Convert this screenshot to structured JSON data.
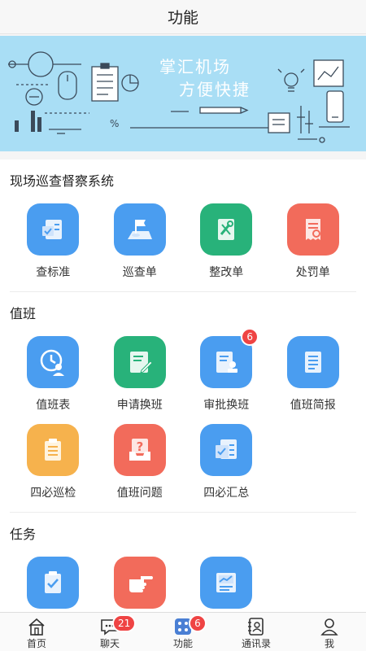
{
  "header": {
    "title": "功能"
  },
  "banner": {
    "line1": "掌汇机场",
    "line2": "方便快捷"
  },
  "sections": [
    {
      "title": "现场巡查督察系统",
      "items": [
        {
          "label": "查标准",
          "color": "#4a9df0",
          "icon": "checklist-icon"
        },
        {
          "label": "巡查单",
          "color": "#4a9df0",
          "icon": "flag-map-icon"
        },
        {
          "label": "整改单",
          "color": "#28b27a",
          "icon": "tools-icon"
        },
        {
          "label": "处罚单",
          "color": "#f26b5b",
          "icon": "receipt-icon"
        }
      ]
    },
    {
      "title": "值班",
      "items": [
        {
          "label": "值班表",
          "color": "#4a9df0",
          "icon": "clock-person-icon"
        },
        {
          "label": "申请换班",
          "color": "#28b27a",
          "icon": "edit-document-icon"
        },
        {
          "label": "审批换班",
          "color": "#4a9df0",
          "icon": "stamp-document-icon",
          "badge": "6"
        },
        {
          "label": "值班简报",
          "color": "#4a9df0",
          "icon": "report-icon"
        },
        {
          "label": "四必巡检",
          "color": "#f6b24d",
          "icon": "clipboard-list-icon"
        },
        {
          "label": "值班问题",
          "color": "#f26b5b",
          "icon": "question-box-icon"
        },
        {
          "label": "四必汇总",
          "color": "#4a9df0",
          "icon": "document-stack-icon"
        }
      ]
    },
    {
      "title": "任务",
      "items": [
        {
          "label": "",
          "color": "#4a9df0",
          "icon": "clipboard-check-icon"
        },
        {
          "label": "",
          "color": "#f26b5b",
          "icon": "pointing-hand-icon"
        },
        {
          "label": "",
          "color": "#4a9df0",
          "icon": "trend-chart-icon"
        }
      ]
    }
  ],
  "tabbar": [
    {
      "label": "首页",
      "icon": "home-icon"
    },
    {
      "label": "聊天",
      "icon": "chat-icon",
      "badge": "21"
    },
    {
      "label": "功能",
      "icon": "grid-icon",
      "badge": "6",
      "active": true
    },
    {
      "label": "通讯录",
      "icon": "contacts-icon"
    },
    {
      "label": "我",
      "icon": "user-icon"
    }
  ]
}
